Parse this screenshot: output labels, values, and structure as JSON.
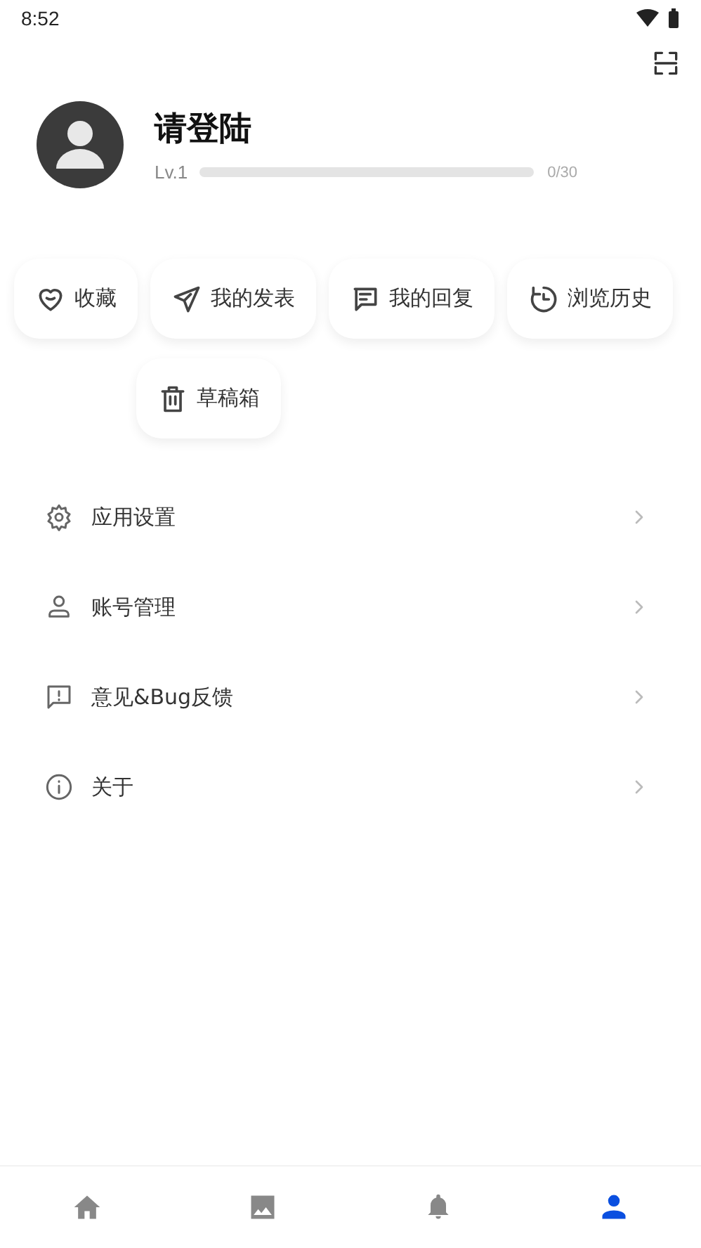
{
  "status_bar": {
    "time": "8:52"
  },
  "profile": {
    "name": "请登陆",
    "level_label": "Lv.1",
    "progress": {
      "reading": "0/30"
    }
  },
  "shortcuts": [
    {
      "kind": "heart",
      "label": "收藏"
    },
    {
      "kind": "send",
      "label": "我的发表"
    },
    {
      "kind": "comment",
      "label": "我的回复"
    },
    {
      "kind": "history",
      "label": "浏览历史"
    },
    {
      "kind": "trash",
      "label": "草稿箱"
    }
  ],
  "menu": [
    {
      "kind": "settings",
      "label": "应用设置"
    },
    {
      "kind": "person",
      "label": "账号管理"
    },
    {
      "kind": "feedback",
      "label": "意见&Bug反馈"
    },
    {
      "kind": "info",
      "label": "关于"
    }
  ],
  "bottom_nav": [
    {
      "kind": "home",
      "selected": false
    },
    {
      "kind": "image",
      "selected": false
    },
    {
      "kind": "bell",
      "selected": false
    },
    {
      "kind": "person",
      "selected": true
    }
  ]
}
